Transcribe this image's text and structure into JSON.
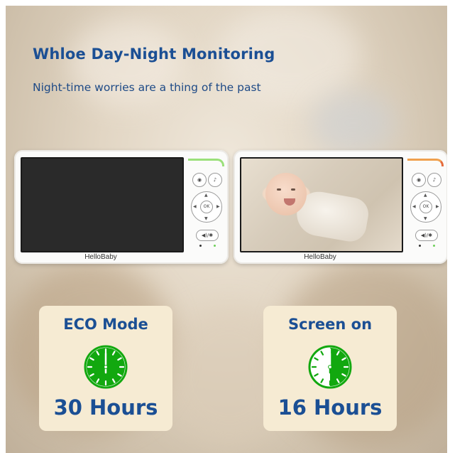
{
  "headline": "Whloe Day-Night Monitoring",
  "subline": "Night-time worries are a thing of the past",
  "monitors": [
    {
      "brand": "HelloBaby",
      "screen": "off",
      "led_color": "#9be07a"
    },
    {
      "brand": "HelloBaby",
      "screen": "baby-photo",
      "led_color": "#e56b3b"
    }
  ],
  "controls": {
    "ok_label": "OK",
    "volume_label": "◀)/✱"
  },
  "cards": [
    {
      "title": "ECO Mode",
      "value": "30 Hours",
      "clock_fill_fraction": 1.0,
      "icon": "clock-full-icon"
    },
    {
      "title": "Screen on",
      "value": "16 Hours",
      "clock_fill_fraction": 0.5,
      "icon": "clock-half-icon"
    }
  ],
  "colors": {
    "title_blue": "#1b4f94",
    "clock_green": "#12a80f",
    "card_bg": "#f6ebd3"
  }
}
